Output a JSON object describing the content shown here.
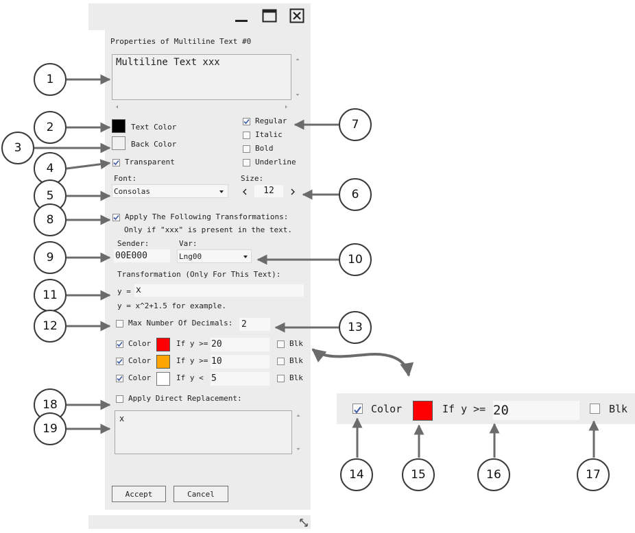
{
  "dialog": {
    "title": "Properties of Multiline Text #0",
    "text_value": "Multiline Text xxx",
    "text_color_label": "Text Color",
    "back_color_label": "Back Color",
    "transparent_label": "Transparent",
    "style_options": [
      "Regular",
      "Italic",
      "Bold",
      "Underline"
    ],
    "font_label": "Font:",
    "font_value": "Consolas",
    "size_label": "Size:",
    "size_value": "12",
    "apply_transform_label": "Apply The Following Transformations:",
    "apply_transform_note": "Only if \"xxx\" is present in the text.",
    "sender_label": "Sender:",
    "sender_value": "00E000",
    "var_label": "Var:",
    "var_value": "Lng00",
    "transformation_label": "Transformation (Only For This Text):",
    "transformation_prefix": "y =",
    "transformation_value": "x",
    "transformation_example": "y = x^2+1.5 for example.",
    "max_decimals_label": "Max Number Of Decimals:",
    "max_decimals_value": "2",
    "color_rules": [
      {
        "label": "Color",
        "condition": "If y >=",
        "value": "20",
        "blk": "Blk",
        "color": "#ff0000"
      },
      {
        "label": "Color",
        "condition": "If y >=",
        "value": "10",
        "blk": "Blk",
        "color": "#ffa500"
      },
      {
        "label": "Color",
        "condition": "If y <",
        "value": "5",
        "blk": "Blk",
        "color": "#ffffff"
      }
    ],
    "direct_replacement_label": "Apply Direct Replacement:",
    "direct_replacement_value": "x",
    "accept_label": "Accept",
    "cancel_label": "Cancel"
  },
  "zoom": {
    "label": "Color",
    "condition": "If y >=",
    "value": "20",
    "blk": "Blk",
    "color": "#ff0000"
  },
  "callouts": [
    "1",
    "2",
    "3",
    "4",
    "5",
    "6",
    "7",
    "8",
    "9",
    "10",
    "11",
    "12",
    "13",
    "14",
    "15",
    "16",
    "17",
    "18",
    "19"
  ],
  "colors": {
    "text_color": "#000000",
    "back_color": "#f0f0f0",
    "panel": "#ececec",
    "check": "#3c5aa6"
  }
}
